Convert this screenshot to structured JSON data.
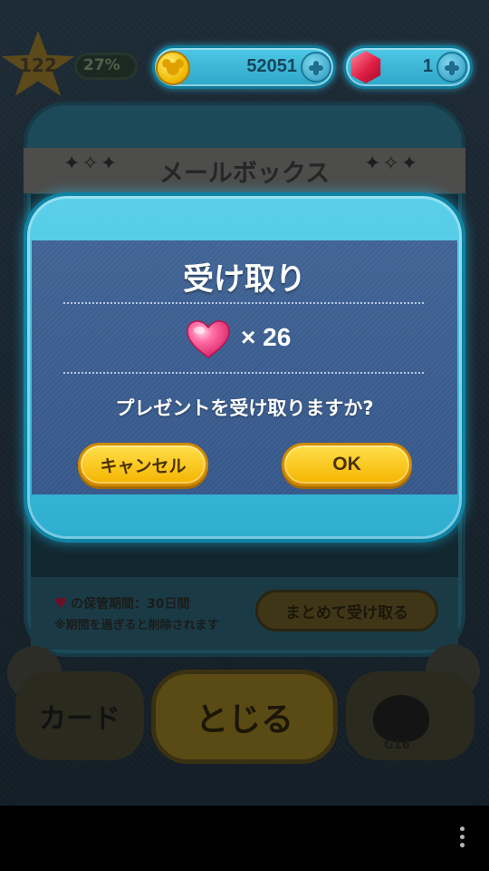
{
  "hud": {
    "level": "122",
    "exp_percent": "27%",
    "coins": "52051",
    "gems": "1"
  },
  "mailbox": {
    "title": "メールボックス",
    "retention_note": "の保管期間：30日間",
    "retention_note_2": "※期間を過ぎると削除されます",
    "receive_all_label": "まとめて受け取る"
  },
  "bottom_nav": {
    "card_label": "カード",
    "close_label": "とじる",
    "tsum_badge": "G16"
  },
  "dialog": {
    "title": "受け取り",
    "reward_item": "heart-icon",
    "reward_multiplier": "× 26",
    "confirm_text": "プレゼントを受け取りますか?",
    "cancel_label": "キャンセル",
    "ok_label": "OK"
  },
  "colors": {
    "dialog_frame": "#2faed0",
    "dialog_body": "#3a5c8f",
    "button_yellow": "#f5b400",
    "heart_pink": "#ff4f8f"
  }
}
